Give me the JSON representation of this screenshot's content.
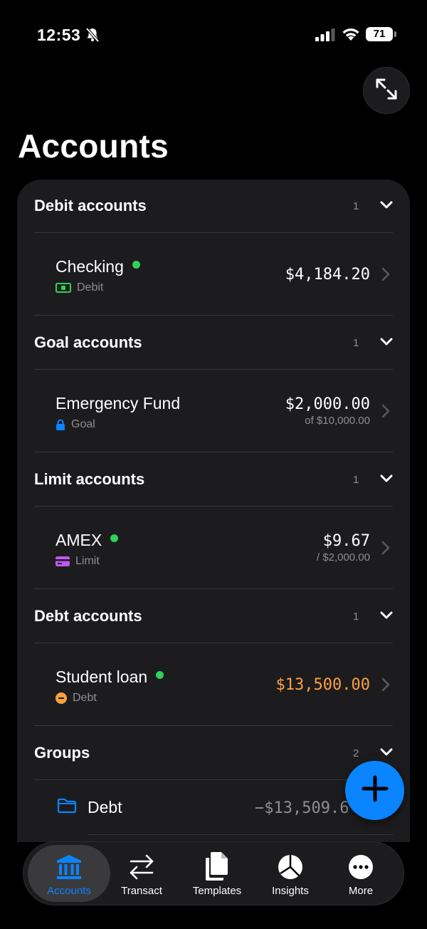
{
  "status_bar": {
    "time": "12:53",
    "battery": "71"
  },
  "page_title": "Accounts",
  "sections": [
    {
      "title": "Debit accounts",
      "count": "1",
      "account": {
        "name": "Checking",
        "type": "Debit",
        "amount": "$4,184.20"
      }
    },
    {
      "title": "Goal accounts",
      "count": "1",
      "account": {
        "name": "Emergency Fund",
        "type": "Goal",
        "amount": "$2,000.00",
        "amount_sub": "of $10,000.00"
      }
    },
    {
      "title": "Limit accounts",
      "count": "1",
      "account": {
        "name": "AMEX",
        "type": "Limit",
        "amount": "$9.67",
        "amount_sub": "/ $2,000.00"
      }
    },
    {
      "title": "Debt accounts",
      "count": "1",
      "account": {
        "name": "Student loan",
        "type": "Debt",
        "amount": "$13,500.00"
      }
    },
    {
      "title": "Groups",
      "count": "2"
    }
  ],
  "groups": [
    {
      "name": "Debt",
      "amount": "−$13,509.6"
    }
  ],
  "tabs": [
    {
      "label": "Accounts",
      "active": true,
      "icon": "bank-icon"
    },
    {
      "label": "Transact",
      "icon": "arrows-icon"
    },
    {
      "label": "Templates",
      "icon": "documents-icon"
    },
    {
      "label": "Insights",
      "icon": "pie-chart-icon"
    },
    {
      "label": "More",
      "icon": "more-icon"
    }
  ],
  "colors": {
    "accent": "#0a84ff",
    "positive_dot": "#30d158",
    "debt_amount": "#ff9f43",
    "card": "#1c1c1e"
  }
}
